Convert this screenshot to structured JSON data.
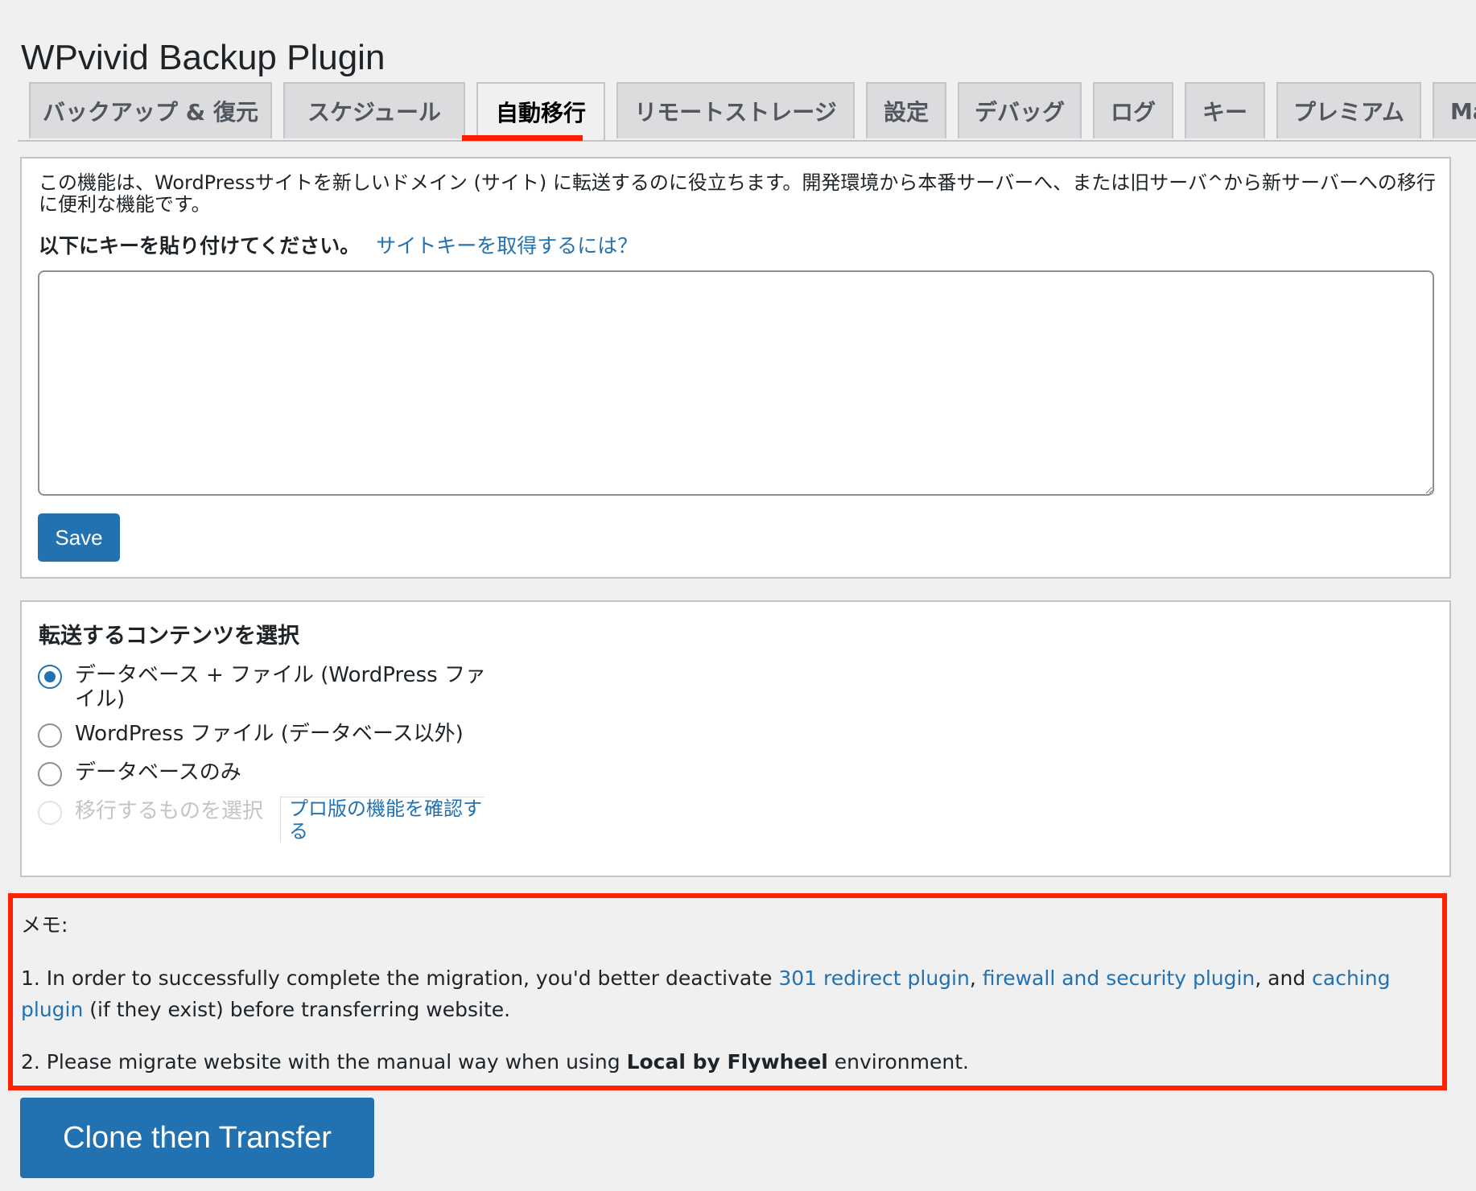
{
  "page_title": "WPvivid Backup Plugin",
  "tabs": [
    {
      "label": "バックアップ & 復元"
    },
    {
      "label": "スケジュール"
    },
    {
      "label": "自動移行",
      "active": true
    },
    {
      "label": "リモートストレージ"
    },
    {
      "label": "設定"
    },
    {
      "label": "デバッグ"
    },
    {
      "label": "ログ"
    },
    {
      "label": "キー"
    },
    {
      "label": "プレミアム"
    },
    {
      "label": "Mai"
    }
  ],
  "key_section": {
    "description": "この機能は、WordPressサイトを新しいドメイン (サイト) に転送するのに役立ちます。開発環境から本番サーバーへ、または旧サーバ^から新サーバーへの移行に便利な機能です。",
    "paste_label": "以下にキーを貼り付けてください。",
    "get_key_link": "サイトキーを取得するには？",
    "textarea_value": "",
    "save_label": "Save"
  },
  "content_section": {
    "heading": "転送するコンテンツを選択",
    "options": [
      {
        "label": "データベース + ファイル (WordPress ファイル)",
        "checked": true
      },
      {
        "label": "WordPress ファイル (データベース以外)",
        "checked": false
      },
      {
        "label": "データベースのみ",
        "checked": false
      },
      {
        "label": "移行するものを選択",
        "checked": false,
        "disabled": true
      }
    ],
    "pro_link": "プロ版の機能を確認する"
  },
  "notes": {
    "title": "メモ:",
    "line1_prefix": "1. In order to successfully complete the migration, you'd better deactivate ",
    "link1": "301 redirect plugin",
    "sep1": ", ",
    "link2": "firewall and security plugin",
    "sep2": ", and ",
    "link3": "caching plugin",
    "line1_suffix": " (if they exist) before transferring website.",
    "line2_prefix": "2. Please migrate website with the manual way when using ",
    "line2_bold": "Local by Flywheel",
    "line2_suffix": " environment."
  },
  "clone_button_label": "Clone then Transfer",
  "colors": {
    "accent": "#2271b1",
    "highlight": "#ff2000",
    "background": "#f0f0f1"
  }
}
